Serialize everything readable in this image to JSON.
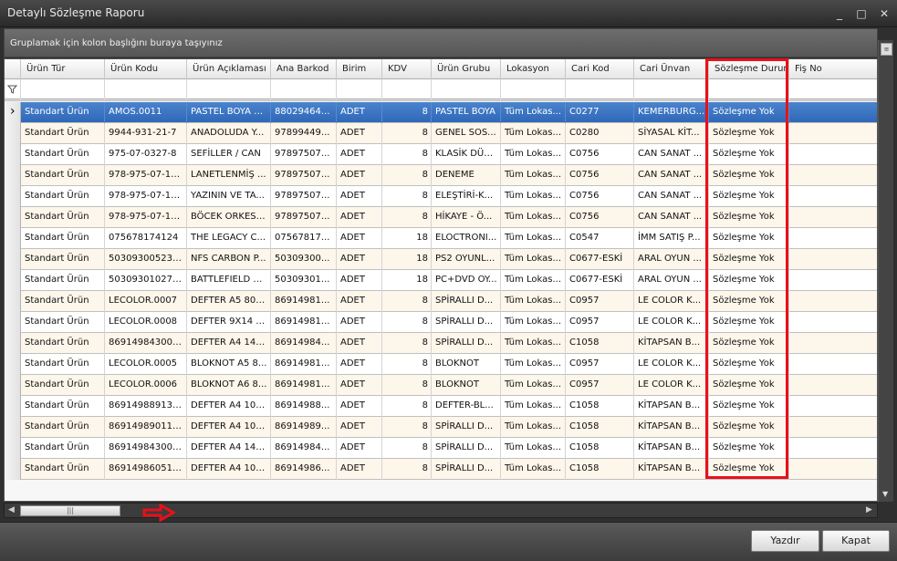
{
  "window": {
    "title": "Detaylı Sözleşme Raporu",
    "minimize_label": "_",
    "maximize_label": "□",
    "close_label": "✕"
  },
  "group_panel": {
    "text": "Gruplamak için kolon başlığını buraya taşıyınız"
  },
  "grid": {
    "columns": [
      "Ürün Tür",
      "Ürün Kodu",
      "Ürün Açıklaması",
      "Ana Barkod",
      "Birim",
      "KDV",
      "Ürün Grubu",
      "Lokasyon",
      "Cari Kod",
      "Cari Ünvan",
      "Sözleşme Durum",
      "Fiş No"
    ],
    "filter_icon": "filter-icon",
    "rows": [
      [
        "Standart Ürün",
        "AMOS.0011",
        "PASTEL BOYA 2...",
        "88029464...",
        "ADET",
        "8",
        "PASTEL BOYA",
        "Tüm Lokas...",
        "C0277",
        "KEMERBURG...",
        "Sözleşme Yok",
        ""
      ],
      [
        "Standart Ürün",
        "9944-931-21-7",
        "ANADOLUDA Y...",
        "97899449...",
        "ADET",
        "8",
        "GENEL SOS...",
        "Tüm Lokas...",
        "C0280",
        "SİYASAL KİT...",
        "Sözleşme Yok",
        ""
      ],
      [
        "Standart Ürün",
        "975-07-0327-8",
        "SEFİLLER / CAN",
        "97897507...",
        "ADET",
        "8",
        "KLASİK DÜN...",
        "Tüm Lokas...",
        "C0756",
        "CAN SANAT ...",
        "Sözleşme Yok",
        ""
      ],
      [
        "Standart Ürün",
        "978-975-07-15...",
        "LANETLENMİŞ ...",
        "97897507...",
        "ADET",
        "8",
        "DENEME",
        "Tüm Lokas...",
        "C0756",
        "CAN SANAT ...",
        "Sözleşme Yok",
        ""
      ],
      [
        "Standart Ürün",
        "978-975-07-15...",
        "YAZININ VE TA...",
        "97897507...",
        "ADET",
        "8",
        "ELEŞTİRİ-K...",
        "Tüm Lokas...",
        "C0756",
        "CAN SANAT ...",
        "Sözleşme Yok",
        ""
      ],
      [
        "Standart Ürün",
        "978-975-07-15...",
        "BÖCEK ORKEST...",
        "97897507...",
        "ADET",
        "8",
        "HİKAYE - Ö...",
        "Tüm Lokas...",
        "C0756",
        "CAN SANAT ...",
        "Sözleşme Yok",
        ""
      ],
      [
        "Standart Ürün",
        "075678174124",
        "THE LEGACY C...",
        "07567817...",
        "ADET",
        "18",
        "ELOCTRONI...",
        "Tüm Lokas...",
        "C0547",
        "İMM SATIŞ P...",
        "Sözleşme Yok",
        ""
      ],
      [
        "Standart Ürün",
        "5030930052331",
        "NFS CARBON P...",
        "50309300...",
        "ADET",
        "18",
        "PS2 OYUNL...",
        "Tüm Lokas...",
        "C0677-ESKİ",
        "ARAL OYUN ...",
        "Sözleşme Yok",
        ""
      ],
      [
        "Standart Ürün",
        "5030930102753",
        "BATTLEFIELD 3...",
        "50309301...",
        "ADET",
        "18",
        "PC+DVD OY...",
        "Tüm Lokas...",
        "C0677-ESKİ",
        "ARAL OYUN ...",
        "Sözleşme Yok",
        ""
      ],
      [
        "Standart Ürün",
        "LECOLOR.0007",
        "DEFTER A5 80/...",
        "86914981...",
        "ADET",
        "8",
        "SPİRALLI D...",
        "Tüm Lokas...",
        "C0957",
        "LE COLOR K...",
        "Sözleşme Yok",
        ""
      ],
      [
        "Standart Ürün",
        "LECOLOR.0008",
        "DEFTER 9X14 8...",
        "86914981...",
        "ADET",
        "8",
        "SPİRALLI D...",
        "Tüm Lokas...",
        "C0957",
        "LE COLOR K...",
        "Sözleşme Yok",
        ""
      ],
      [
        "Standart Ürün",
        "8691498430039",
        "DEFTER A4 140...",
        "86914984...",
        "ADET",
        "8",
        "SPİRALLI D...",
        "Tüm Lokas...",
        "C1058",
        "KİTAPSAN B...",
        "Sözleşme Yok",
        ""
      ],
      [
        "Standart Ürün",
        "LECOLOR.0005",
        "BLOKNOT A5 8...",
        "86914981...",
        "ADET",
        "8",
        "BLOKNOT",
        "Tüm Lokas...",
        "C0957",
        "LE COLOR K...",
        "Sözleşme Yok",
        ""
      ],
      [
        "Standart Ürün",
        "LECOLOR.0006",
        "BLOKNOT A6 8...",
        "86914981...",
        "ADET",
        "8",
        "BLOKNOT",
        "Tüm Lokas...",
        "C0957",
        "LE COLOR K...",
        "Sözleşme Yok",
        ""
      ],
      [
        "Standart Ürün",
        "8691498891304",
        "DEFTER A4 100...",
        "86914988...",
        "ADET",
        "8",
        "DEFTER-BL...",
        "Tüm Lokas...",
        "C1058",
        "KİTAPSAN B...",
        "Sözleşme Yok",
        ""
      ],
      [
        "Standart Ürün",
        "8691498901102",
        "DEFTER A4 100...",
        "86914989...",
        "ADET",
        "8",
        "SPİRALLI D...",
        "Tüm Lokas...",
        "C1058",
        "KİTAPSAN B...",
        "Sözleşme Yok",
        ""
      ],
      [
        "Standart Ürün",
        "8691498430084",
        "DEFTER A4 140...",
        "86914984...",
        "ADET",
        "8",
        "SPİRALLI D...",
        "Tüm Lokas...",
        "C1058",
        "KİTAPSAN B...",
        "Sözleşme Yok",
        ""
      ],
      [
        "Standart Ürün",
        "8691498605116",
        "DEFTER A4 100...",
        "86914986...",
        "ADET",
        "8",
        "SPİRALLI D...",
        "Tüm Lokas...",
        "C1058",
        "KİTAPSAN B...",
        "Sözleşme Yok",
        ""
      ]
    ],
    "selected_row": 0,
    "highlight_color": "#e8101a",
    "selection_color": "#3a72c2"
  },
  "footer": {
    "print_label": "Yazdır",
    "close_label": "Kapat"
  }
}
